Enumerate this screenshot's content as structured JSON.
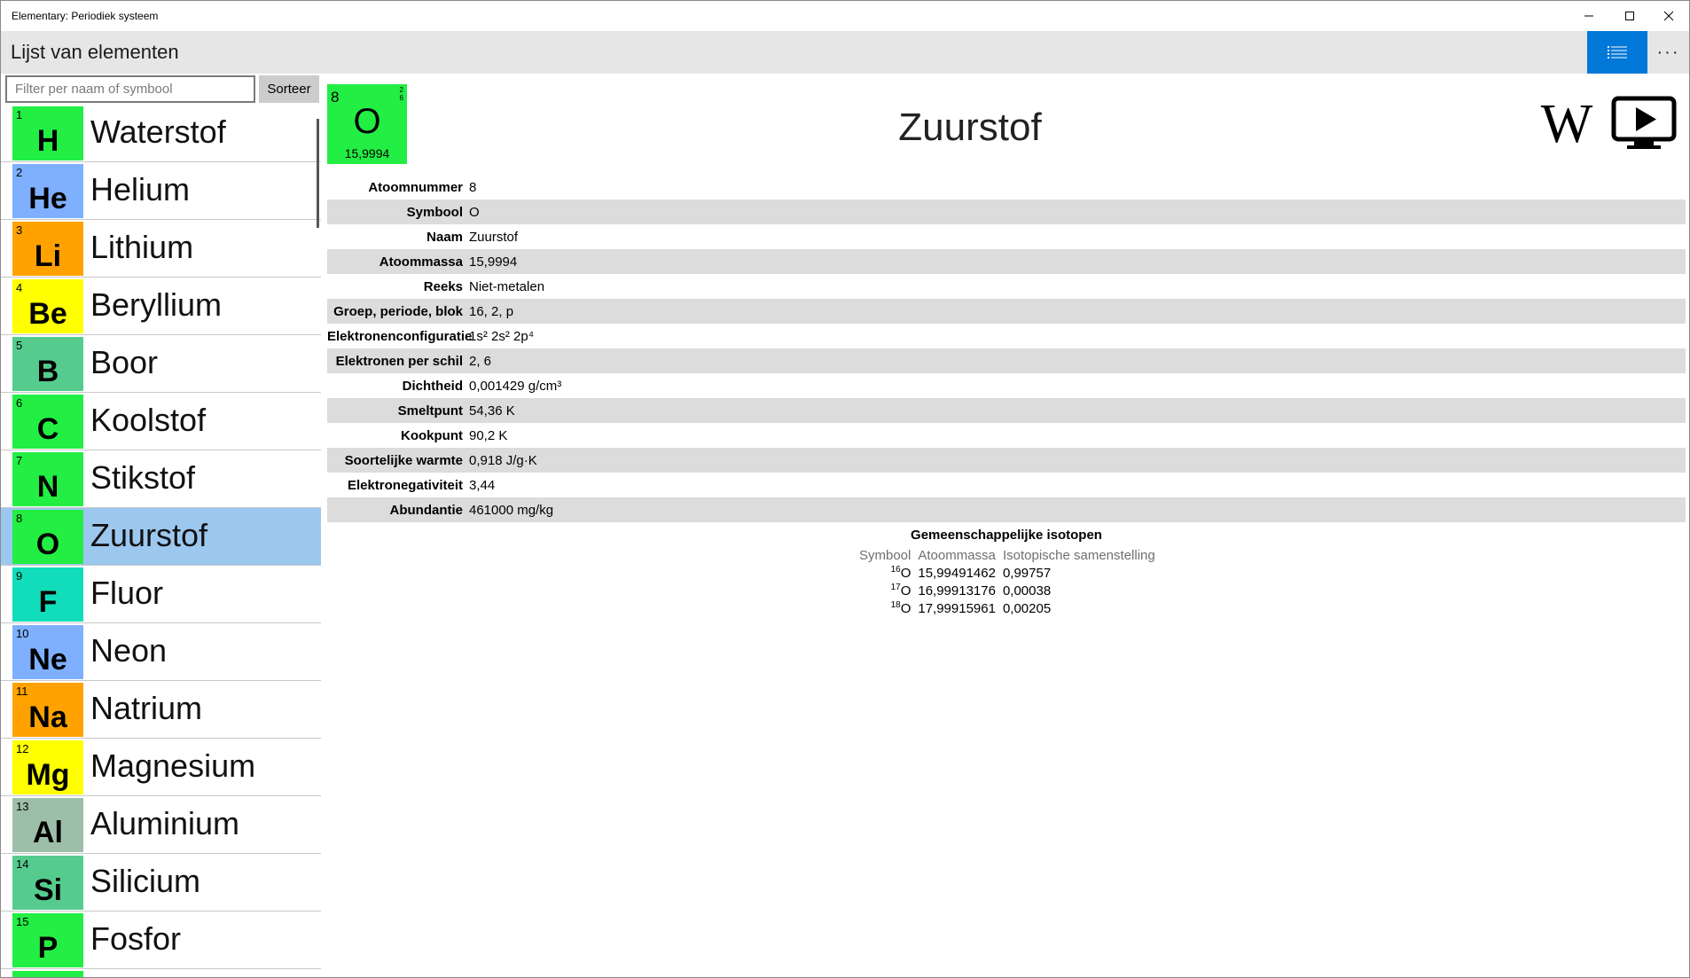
{
  "window": {
    "title": "Elementary: Periodiek systeem"
  },
  "header": {
    "title": "Lijst van elementen",
    "more_label": "···"
  },
  "sidebar": {
    "filter_placeholder": "Filter per naam of symbool",
    "sort_label": "Sorteer",
    "elements": [
      {
        "number": "1",
        "symbol": "H",
        "name": "Waterstof",
        "color": "#22ee44",
        "selected": false
      },
      {
        "number": "2",
        "symbol": "He",
        "name": "Helium",
        "color": "#7fb0ff",
        "selected": false
      },
      {
        "number": "3",
        "symbol": "Li",
        "name": "Lithium",
        "color": "#ffa200",
        "selected": false
      },
      {
        "number": "4",
        "symbol": "Be",
        "name": "Beryllium",
        "color": "#ffff00",
        "selected": false
      },
      {
        "number": "5",
        "symbol": "B",
        "name": "Boor",
        "color": "#55cc8e",
        "selected": false
      },
      {
        "number": "6",
        "symbol": "C",
        "name": "Koolstof",
        "color": "#22ee44",
        "selected": false
      },
      {
        "number": "7",
        "symbol": "N",
        "name": "Stikstof",
        "color": "#22ee44",
        "selected": false
      },
      {
        "number": "8",
        "symbol": "O",
        "name": "Zuurstof",
        "color": "#22ee44",
        "selected": true
      },
      {
        "number": "9",
        "symbol": "F",
        "name": "Fluor",
        "color": "#11ddbb",
        "selected": false
      },
      {
        "number": "10",
        "symbol": "Ne",
        "name": "Neon",
        "color": "#7fb0ff",
        "selected": false
      },
      {
        "number": "11",
        "symbol": "Na",
        "name": "Natrium",
        "color": "#ffa200",
        "selected": false
      },
      {
        "number": "12",
        "symbol": "Mg",
        "name": "Magnesium",
        "color": "#ffff00",
        "selected": false
      },
      {
        "number": "13",
        "symbol": "Al",
        "name": "Aluminium",
        "color": "#9dbfa9",
        "selected": false
      },
      {
        "number": "14",
        "symbol": "Si",
        "name": "Silicium",
        "color": "#55cc8e",
        "selected": false
      },
      {
        "number": "15",
        "symbol": "P",
        "name": "Fosfor",
        "color": "#22ee44",
        "selected": false
      },
      {
        "number": "",
        "symbol": "",
        "name": "",
        "color": "#22ee44",
        "selected": false
      }
    ]
  },
  "detail": {
    "name": "Zuurstof",
    "tile": {
      "number": "8",
      "symbol": "O",
      "mass": "15,9994",
      "shell1": "2",
      "shell2": "6",
      "color": "#22ee44"
    },
    "properties": [
      {
        "label": "Atoomnummer",
        "value": "8"
      },
      {
        "label": "Symbool",
        "value": "O"
      },
      {
        "label": "Naam",
        "value": "Zuurstof"
      },
      {
        "label": "Atoommassa",
        "value": "15,9994"
      },
      {
        "label": "Reeks",
        "value": "Niet-metalen"
      },
      {
        "label": "Groep, periode, blok",
        "value": "16, 2, p"
      },
      {
        "label": "Elektronenconfiguratie",
        "value": "1s² 2s² 2p⁴"
      },
      {
        "label": "Elektronen per schil",
        "value": "2, 6"
      },
      {
        "label": "Dichtheid",
        "value": "0,001429 g/cm³"
      },
      {
        "label": "Smeltpunt",
        "value": "54,36 K"
      },
      {
        "label": "Kookpunt",
        "value": "90,2 K"
      },
      {
        "label": "Soortelijke warmte",
        "value": "0,918 J/g·K"
      },
      {
        "label": "Elektronegativiteit",
        "value": "3,44"
      },
      {
        "label": "Abundantie",
        "value": "461000 mg/kg"
      }
    ],
    "isotopes": {
      "title": "Gemeenschappelijke isotopen",
      "headers": {
        "symbol": "Symbool",
        "mass": "Atoommassa",
        "composition": "Isotopische samenstelling"
      },
      "rows": [
        {
          "mass_number": "16",
          "symbol": "O",
          "mass": "15,99491462",
          "composition": "0,99757"
        },
        {
          "mass_number": "17",
          "symbol": "O",
          "mass": "16,99913176",
          "composition": "0,00038"
        },
        {
          "mass_number": "18",
          "symbol": "O",
          "mass": "17,99915961",
          "composition": "0,00205"
        }
      ]
    },
    "links": {
      "wikipedia_label": "W"
    }
  }
}
